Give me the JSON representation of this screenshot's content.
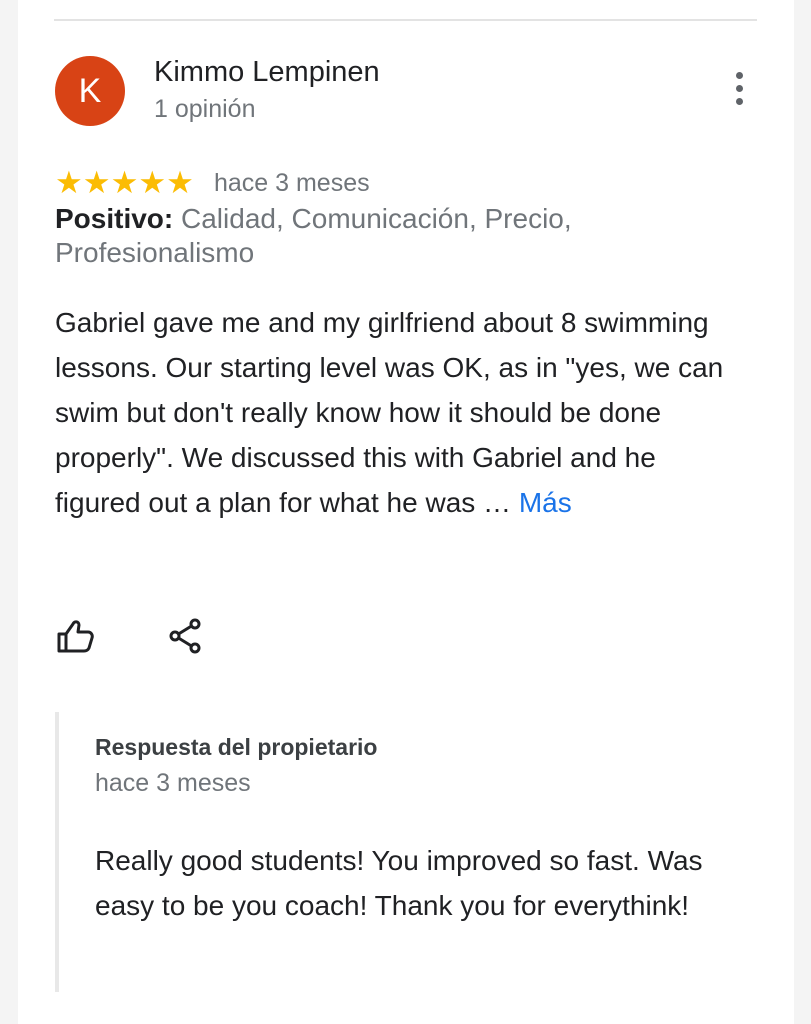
{
  "review": {
    "reviewer_name": "Kimmo Lempinen",
    "avatar_initial": "K",
    "avatar_color": "#d84315",
    "review_count": "1 opinión",
    "rating": 5,
    "rating_max": 5,
    "stars_text": "★★★★★",
    "star_color": "#fbbc04",
    "time_ago": "hace 3 meses",
    "positive_label": "Positivo:",
    "positive_items": "Calidad, Comunicación, Precio, Profesionalismo",
    "text": "Gabriel gave me and my girlfriend about 8 swimming lessons. Our starting level was OK, as in \"yes, we can swim but don't really know how it should be done properly\". We discussed this with Gabriel and he figured out a plan for what he was …",
    "more_link": "Más",
    "link_color": "#1a73e8",
    "icons": {
      "menu": "more-vert-icon",
      "like": "thumb-up-icon",
      "share": "share-icon"
    }
  },
  "owner_reply": {
    "title": "Respuesta del propietario",
    "time_ago": "hace 3 meses",
    "text": "Really good students! You improved so fast. Was easy to be you coach! Thank you for everythink!"
  }
}
